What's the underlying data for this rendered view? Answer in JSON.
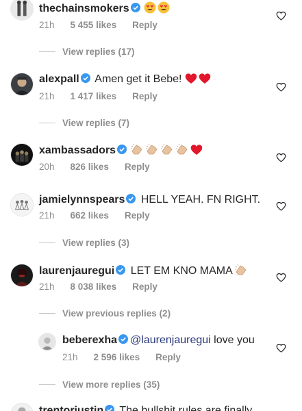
{
  "comments": [
    {
      "username": "thechainsmokers",
      "text": "",
      "emojis": [
        "heart-eyes-emoji",
        "heart-eyes-emoji"
      ],
      "time": "21h",
      "likes": "5 455 likes",
      "reply": "Reply",
      "view_replies": "View replies (17)"
    },
    {
      "username": "alexpall",
      "text": "Amen get it Bebe!",
      "emojis": [
        "red-heart-emoji",
        "red-heart-emoji"
      ],
      "time": "21h",
      "likes": "1 417 likes",
      "reply": "Reply",
      "view_replies": "View replies (7)"
    },
    {
      "username": "xambassadors",
      "text": "",
      "emojis": [
        "clapping-hands-emoji",
        "clapping-hands-emoji",
        "clapping-hands-emoji",
        "clapping-hands-emoji",
        "red-heart-emoji"
      ],
      "time": "20h",
      "likes": "826 likes",
      "reply": "Reply"
    },
    {
      "username": "jamielynnspears",
      "text": "HELL YEAH. FN RIGHT.",
      "time": "21h",
      "likes": "662 likes",
      "reply": "Reply",
      "view_replies": "View replies (3)"
    },
    {
      "username": "laurenjauregui",
      "text": "LET EM KNO MAMA",
      "emojis": [
        "clapping-hands-emoji"
      ],
      "time": "21h",
      "likes": "8 038 likes",
      "reply": "Reply",
      "view_replies": "View previous replies (2)"
    },
    {
      "username": "beberexha",
      "mention": "@laurenjauregui",
      "text": "love you",
      "time": "21h",
      "likes": "2 596 likes",
      "reply": "Reply",
      "view_replies": "View more replies (35)"
    },
    {
      "username": "trentoriustin",
      "text": "The bullshit rules are finally"
    }
  ],
  "colors": {
    "text": "#262626",
    "meta": "#8e8e8e",
    "verified": "#3897f0",
    "mention": "#27377a",
    "heart_outline": "#262626"
  },
  "icons": {
    "verified": "verified-badge-icon",
    "like": "heart-outline-icon"
  }
}
